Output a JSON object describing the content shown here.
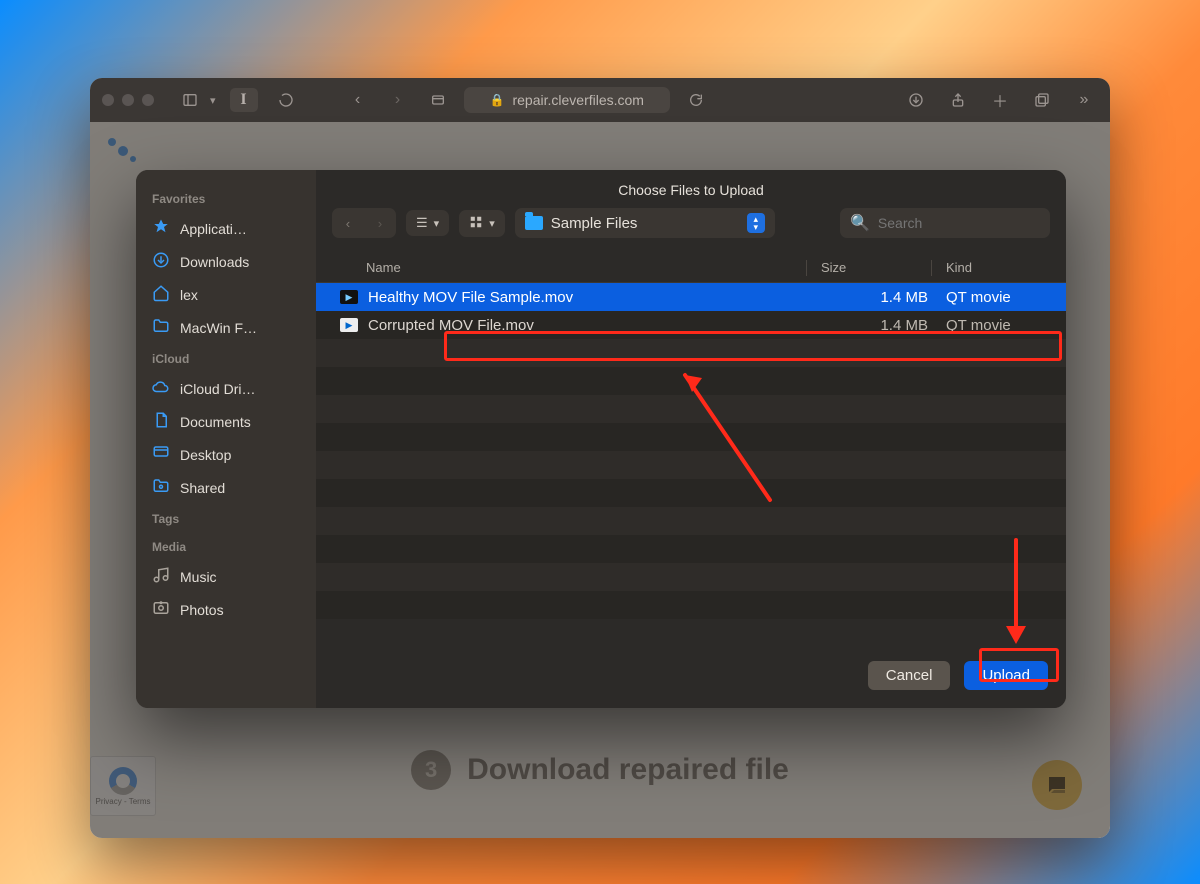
{
  "browser": {
    "url_host": "repair.cleverfiles.com"
  },
  "page": {
    "step_number": "3",
    "step_text": "Download repaired file",
    "recaptcha_label": "Privacy - Terms"
  },
  "sheet": {
    "title": "Choose Files to Upload",
    "location": "Sample Files",
    "search_placeholder": "Search",
    "columns": {
      "name": "Name",
      "size": "Size",
      "kind": "Kind"
    },
    "buttons": {
      "cancel": "Cancel",
      "upload": "Upload"
    },
    "files": [
      {
        "name": "Healthy MOV File Sample.mov",
        "size": "1.4 MB",
        "kind": "QT movie",
        "selected": true,
        "icon": "mov"
      },
      {
        "name": "Corrupted MOV File.mov",
        "size": "1.4 MB",
        "kind": "QT movie",
        "selected": false,
        "icon": "qt"
      }
    ]
  },
  "sidebar": {
    "sections": [
      {
        "title": "Favorites",
        "items": [
          {
            "label": "Applicati…",
            "icon": "app"
          },
          {
            "label": "Downloads",
            "icon": "download"
          },
          {
            "label": "lex",
            "icon": "home"
          },
          {
            "label": "MacWin F…",
            "icon": "folder"
          }
        ]
      },
      {
        "title": "iCloud",
        "items": [
          {
            "label": "iCloud Dri…",
            "icon": "cloud"
          },
          {
            "label": "Documents",
            "icon": "doc"
          },
          {
            "label": "Desktop",
            "icon": "desktop"
          },
          {
            "label": "Shared",
            "icon": "shared"
          }
        ]
      },
      {
        "title": "Tags",
        "items": []
      },
      {
        "title": "Media",
        "items": [
          {
            "label": "Music",
            "icon": "music"
          },
          {
            "label": "Photos",
            "icon": "photos"
          }
        ]
      }
    ]
  }
}
